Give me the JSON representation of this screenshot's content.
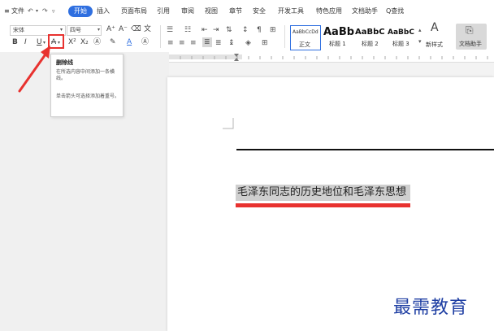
{
  "menubar": {
    "menu_icon": "≡",
    "file_label": "文件",
    "tabs": [
      "开始",
      "插入",
      "页面布局",
      "引用",
      "审阅",
      "视图",
      "章节",
      "安全",
      "开发工具",
      "特色应用",
      "文档助手"
    ],
    "search_label": "Q查找"
  },
  "ribbon": {
    "font_name": "宋体",
    "font_size": "四号",
    "bold": "B",
    "italic": "I",
    "underline": "U",
    "strike": "A",
    "superscript": "X²",
    "subscript": "X₂",
    "styles": [
      {
        "preview": "AaBbCcDd",
        "label": "正文"
      },
      {
        "preview": "AaBb",
        "label": "标题 1"
      },
      {
        "preview": "AaBbC",
        "label": "标题 2"
      },
      {
        "preview": "AaBbC",
        "label": "标题 3"
      }
    ],
    "new_style_label": "新样式",
    "doc_assistant_label": "文档助手"
  },
  "tooltip": {
    "title": "删除线",
    "line1": "在所选内容中间添加一条横线。",
    "line2": "单击箭头可选择添加着重号。"
  },
  "document": {
    "text": "毛泽东同志的历史地位和毛泽东思想"
  },
  "watermark": "最需教育",
  "colors": {
    "accent": "#2f6fe0",
    "highlight": "#cfcfcf",
    "annotation_red": "#e8322f",
    "watermark_blue": "#1f3fa3"
  }
}
